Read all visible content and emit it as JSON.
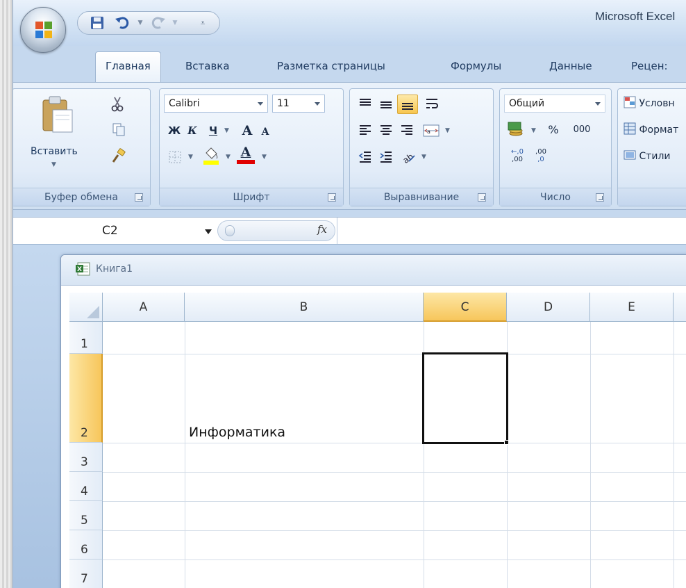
{
  "window": {
    "title": "Microsoft Excel"
  },
  "ribbon_tabs": [
    "Главная",
    "Вставка",
    "Разметка страницы",
    "Формулы",
    "Данные",
    "Рецен:"
  ],
  "clipboard": {
    "paste_label": "Вставить",
    "group_label": "Буфер обмена"
  },
  "font": {
    "name": "Calibri",
    "size": "11",
    "bold": "Ж",
    "italic": "К",
    "underline": "Ч",
    "grow": "A",
    "shrink": "A",
    "color_letter": "A",
    "group_label": "Шрифт",
    "highlight_color": "#ffff00",
    "text_color": "#e00000"
  },
  "alignment": {
    "group_label": "Выравнивание"
  },
  "number": {
    "format": "Общий",
    "percent": "%",
    "thousands": "000",
    "inc_decimal": ",00",
    "dec_decimal": ",0",
    "group_label": "Число"
  },
  "styles": {
    "conditional": "Условн",
    "format_table": "Формат",
    "cell_styles": "Стили"
  },
  "formula_bar": {
    "name_box": "C2",
    "fx": "fx",
    "value": ""
  },
  "workbook": {
    "name": "Книга1",
    "columns": [
      "A",
      "B",
      "C",
      "D",
      "E"
    ],
    "selected_column": "C",
    "rows": [
      "1",
      "2",
      "3",
      "4",
      "5",
      "6",
      "7"
    ],
    "selected_row": "2",
    "active_cell": "C2",
    "cells": {
      "B2": "Информатика"
    }
  },
  "colors": {
    "selection_header": "#f7c65b",
    "ribbon_bg": "#dce8f6",
    "active_border": "#111111"
  }
}
